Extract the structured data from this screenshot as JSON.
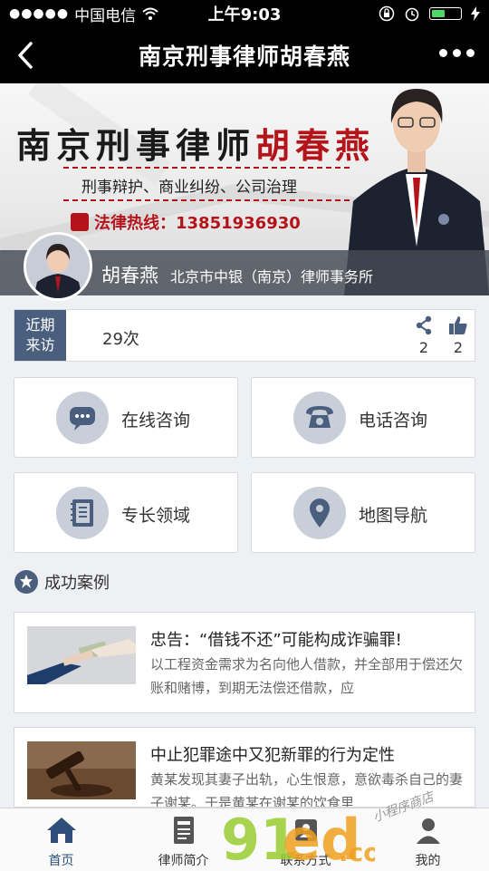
{
  "status_bar": {
    "carrier": "中国电信",
    "time": "上午9:03"
  },
  "nav": {
    "title": "南京刑事律师胡春燕"
  },
  "banner": {
    "heading_black": "南京刑事律师",
    "heading_red": "胡春燕",
    "subtitle": "刑事辩护、商业纠纷、公司治理",
    "hotline": "法律热线：13851936930",
    "name": "胡春燕",
    "firm": "北京市中银（南京）律师事务所"
  },
  "visits": {
    "label_line1": "近期",
    "label_line2": "来访",
    "count": "29次",
    "shares": "2",
    "likes": "2"
  },
  "tiles": [
    {
      "label": "在线咨询",
      "icon": "chat-icon"
    },
    {
      "label": "电话咨询",
      "icon": "phone-icon"
    },
    {
      "label": "专长领域",
      "icon": "notebook-icon"
    },
    {
      "label": "地图导航",
      "icon": "location-pin-icon"
    }
  ],
  "section": {
    "title": "成功案例"
  },
  "cases": [
    {
      "title": "忠告：“借钱不还”可能构成诈骗罪!",
      "desc": "以工程资金需求为名向他人借款，并全部用于偿还欠账和赌博，到期无法偿还借款，应"
    },
    {
      "title": "中止犯罪途中又犯新罪的行为定性",
      "desc": "黄某发现其妻子出轨，心生恨意，意欲毒杀自己的妻子谢某。于是黄某在谢某的饮食里"
    }
  ],
  "tabs": [
    {
      "label": "首页",
      "icon": "home-icon"
    },
    {
      "label": "律师简介",
      "icon": "profile-doc-icon"
    },
    {
      "label": "联系方式",
      "icon": "contact-icon"
    },
    {
      "label": "我的",
      "icon": "user-icon"
    }
  ],
  "watermark": {
    "logo": "91ed.com",
    "text": "小程序商店"
  },
  "colors": {
    "accent": "#4a5f7e",
    "tab_active": "#2e4f7a",
    "red": "#b5131a"
  }
}
